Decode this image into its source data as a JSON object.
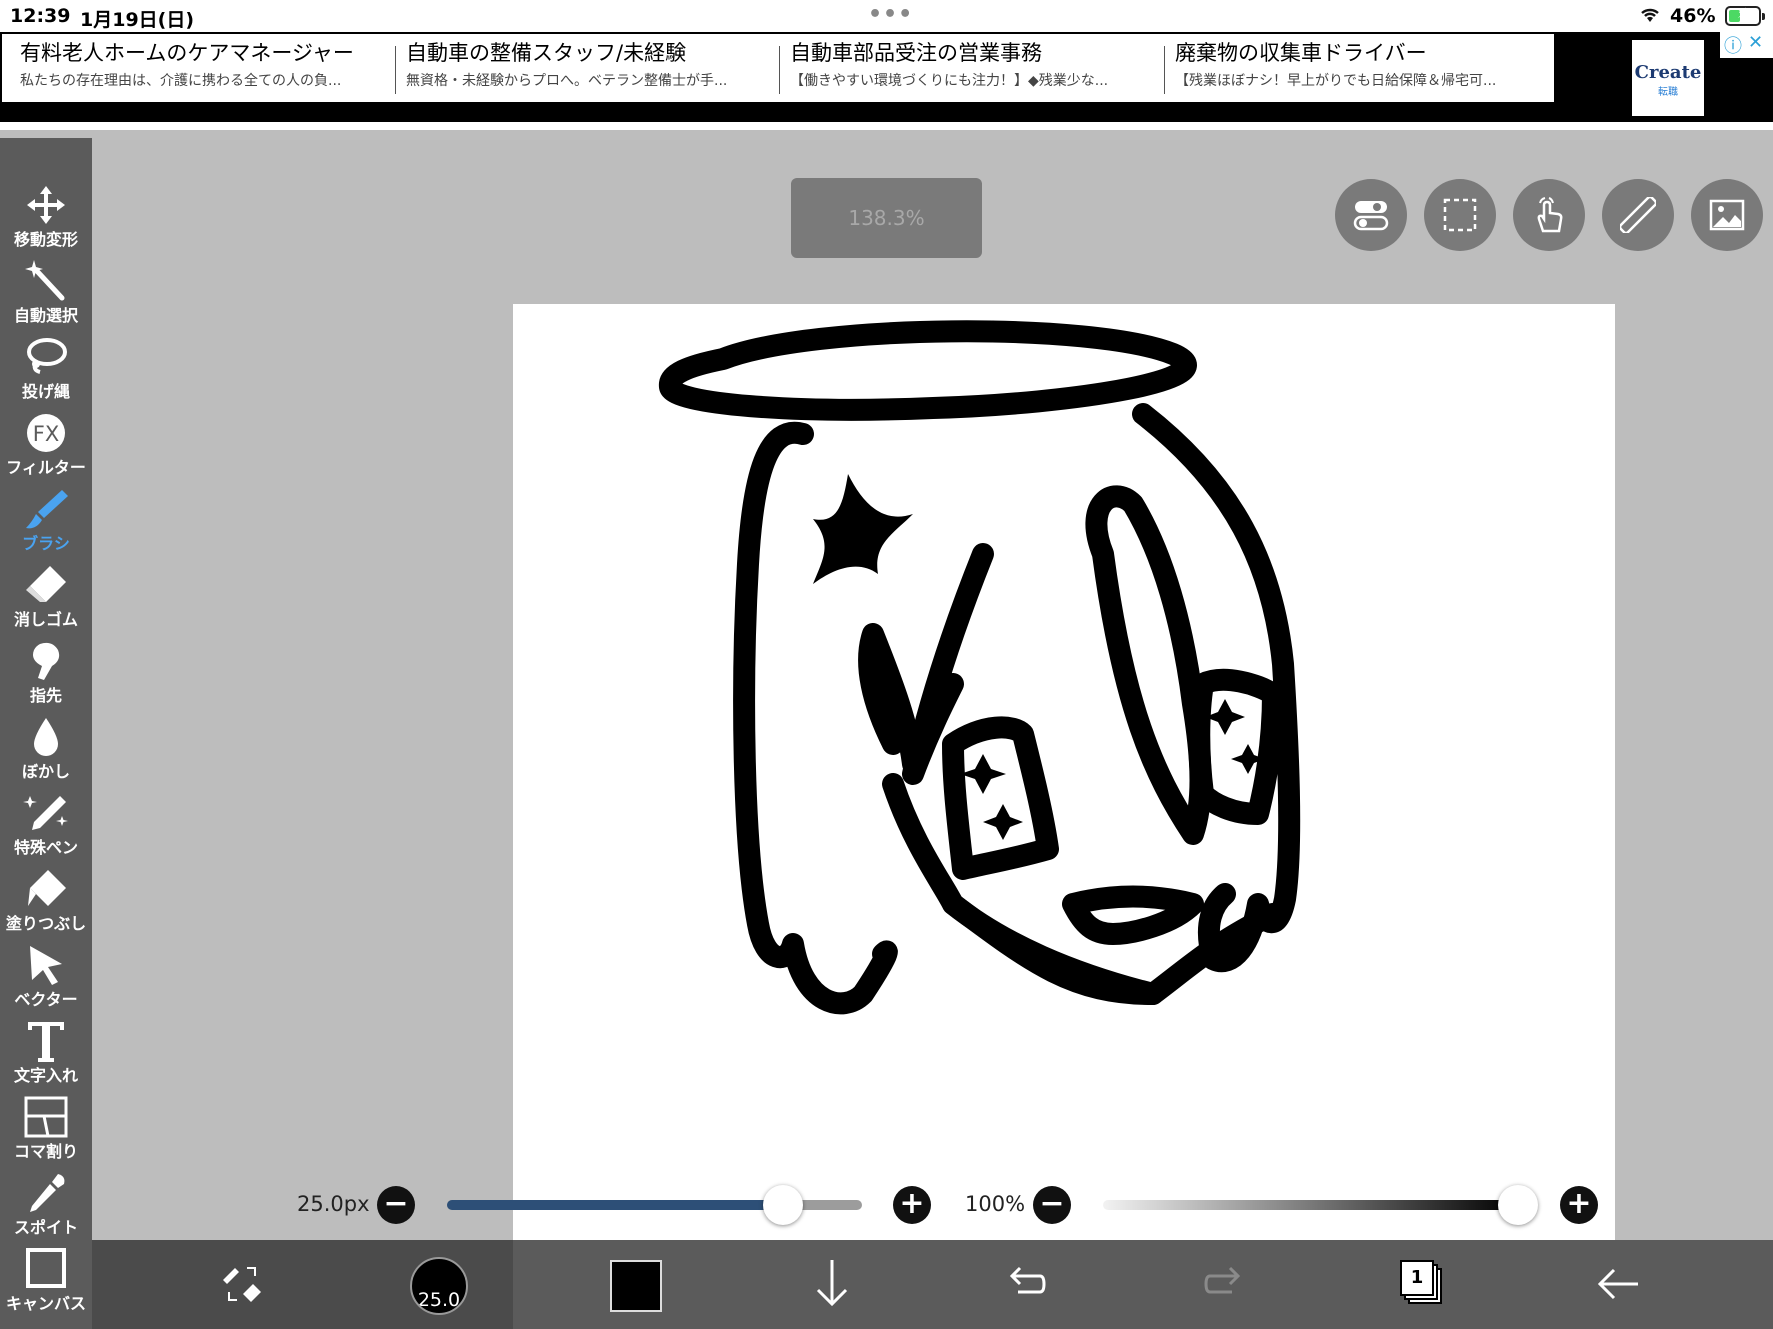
{
  "status_bar": {
    "time": "12:39",
    "date": "1月19日(日)",
    "battery_percent_label": "46%",
    "battery_level": 0.46
  },
  "ad_banner": {
    "items": [
      {
        "title": "有料老人ホームのケアマネージャー",
        "subtitle": "私たちの存在理由は、介護に携わる全ての人の負..."
      },
      {
        "title": "自動車の整備スタッフ/未経験",
        "subtitle": "無資格・未経験からプロへ。ベテラン整備士が手..."
      },
      {
        "title": "自動車部品受注の営業事務",
        "subtitle": "【働きやすい環境づくりにも注力！】◆残業少な..."
      },
      {
        "title": "廃棄物の収集車ドライバー",
        "subtitle": "【残業ほぼナシ！早上がりでも日給保障＆帰宅可..."
      }
    ],
    "logo_text": "Create",
    "logo_sub": "転職"
  },
  "toolbar": {
    "tools": [
      {
        "label": "移動変形",
        "icon": "move-transform-icon"
      },
      {
        "label": "自動選択",
        "icon": "magic-wand-icon"
      },
      {
        "label": "投げ縄",
        "icon": "lasso-icon"
      },
      {
        "label": "フィルター",
        "icon": "fx-filter-icon"
      },
      {
        "label": "ブラシ",
        "icon": "brush-icon",
        "active": true
      },
      {
        "label": "消しゴム",
        "icon": "eraser-icon"
      },
      {
        "label": "指先",
        "icon": "finger-smudge-icon"
      },
      {
        "label": "ぼかし",
        "icon": "blur-drop-icon"
      },
      {
        "label": "特殊ペン",
        "icon": "special-pen-icon"
      },
      {
        "label": "塗りつぶし",
        "icon": "fill-bucket-icon"
      },
      {
        "label": "ベクター",
        "icon": "vector-arrow-icon"
      },
      {
        "label": "文字入れ",
        "icon": "text-icon"
      },
      {
        "label": "コマ割り",
        "icon": "frame-divider-icon"
      },
      {
        "label": "スポイト",
        "icon": "eyedropper-icon"
      },
      {
        "label": "キャンバス",
        "icon": "canvas-icon"
      }
    ]
  },
  "canvas": {
    "zoom_label": "138.3%"
  },
  "sliders": {
    "brush_size_label": "25.0px",
    "brush_size_fraction": 0.81,
    "opacity_label": "100%",
    "opacity_fraction": 1.0
  },
  "bottom_bar": {
    "brush_size_value": "25.0",
    "layer_count": "1"
  },
  "colors": {
    "accent": "#4aa3f0",
    "toolbar_bg": "#5b5b5b",
    "canvas_bg": "#bdbdbd",
    "size_slider_fill": "#2d4f77",
    "current_color": "#000000"
  }
}
